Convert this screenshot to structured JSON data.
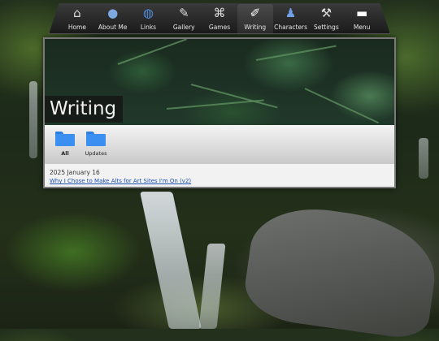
{
  "nav": {
    "items": [
      {
        "label": "Home",
        "icon": "home-icon",
        "glyph": "⌂"
      },
      {
        "label": "About Me",
        "icon": "user-avatar-icon",
        "glyph": "●"
      },
      {
        "label": "Links",
        "icon": "globe-icon",
        "glyph": "◍"
      },
      {
        "label": "Gallery",
        "icon": "pen-tablet-icon",
        "glyph": "✎"
      },
      {
        "label": "Games",
        "icon": "gamepad-icon",
        "glyph": "⌘"
      },
      {
        "label": "Writing",
        "icon": "notepad-icon",
        "glyph": "✐"
      },
      {
        "label": "Characters",
        "icon": "character-figure-icon",
        "glyph": "♟"
      },
      {
        "label": "Settings",
        "icon": "wrench-icon",
        "glyph": "⚒"
      },
      {
        "label": "Menu",
        "icon": "folder-icon",
        "glyph": "▬"
      }
    ],
    "active": "Writing"
  },
  "page": {
    "title": "Writing"
  },
  "folders": [
    {
      "label": "All"
    },
    {
      "label": "Updates"
    }
  ],
  "posts": [
    {
      "date": "2025 January 16",
      "title": "Why I Chose to Make Alts for Art Sites I'm On (v2)"
    }
  ],
  "colors": {
    "folder": "#3b8ff0",
    "link": "#1a4fb3",
    "navbar": "#1b1b1b"
  }
}
